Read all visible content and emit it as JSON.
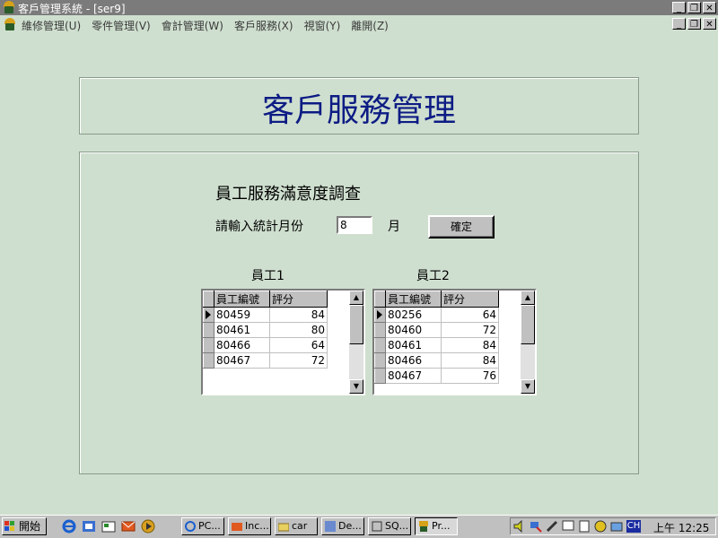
{
  "window": {
    "title": "客戶管理系統 - [ser9]"
  },
  "menu": [
    "維修管理(U)",
    "零件管理(V)",
    "會計管理(W)",
    "客戶服務(X)",
    "視窗(Y)",
    "離開(Z)"
  ],
  "page": {
    "title": "客戶服務管理",
    "survey_title": "員工服務滿意度調查",
    "month_label": "請輸入統計月份",
    "month_value": "8",
    "month_unit": "月",
    "confirm_label": "確定"
  },
  "grids": [
    {
      "label": "員工1",
      "columns": [
        "員工編號",
        "評分"
      ],
      "rows": [
        [
          "80459",
          "84"
        ],
        [
          "80461",
          "80"
        ],
        [
          "80466",
          "64"
        ],
        [
          "80467",
          "72"
        ]
      ]
    },
    {
      "label": "員工2",
      "columns": [
        "員工編號",
        "評分"
      ],
      "rows": [
        [
          "80256",
          "64"
        ],
        [
          "80460",
          "72"
        ],
        [
          "80461",
          "84"
        ],
        [
          "80466",
          "84"
        ],
        [
          "80467",
          "76"
        ]
      ]
    }
  ],
  "taskbar": {
    "start_label": "開始",
    "tasks": [
      "PC...",
      "Inc...",
      "car",
      "De...",
      "SQ...",
      "Pr..."
    ],
    "clock": "上午 12:25",
    "ime": "CH"
  },
  "colors": {
    "background": "#cfdfcf",
    "title_text": "#0d1c84",
    "titlebar": "#7b7b7b"
  }
}
